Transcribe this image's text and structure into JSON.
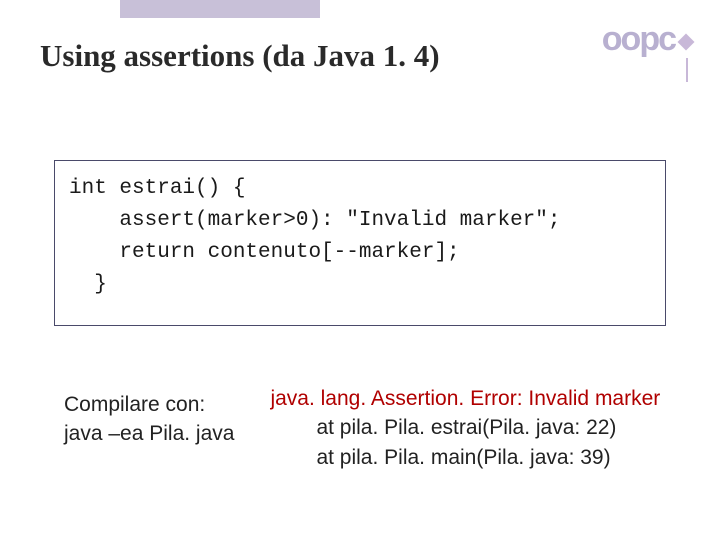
{
  "logo": {
    "text": "oopc"
  },
  "title": "Using assertions (da Java 1. 4)",
  "code": {
    "line1": "int estrai() {",
    "line2": "    assert(marker>0): \"Invalid marker\";",
    "line3": "    return contenuto[--marker];",
    "line4": "  }"
  },
  "compile": {
    "line1": "Compilare con:",
    "line2": "java –ea Pila. java"
  },
  "error": {
    "head": "java. lang. Assertion. Error: Invalid marker",
    "trace1": "at pila. Pila. estrai(Pila. java: 22)",
    "trace2": "at pila. Pila. main(Pila. java: 39)"
  }
}
